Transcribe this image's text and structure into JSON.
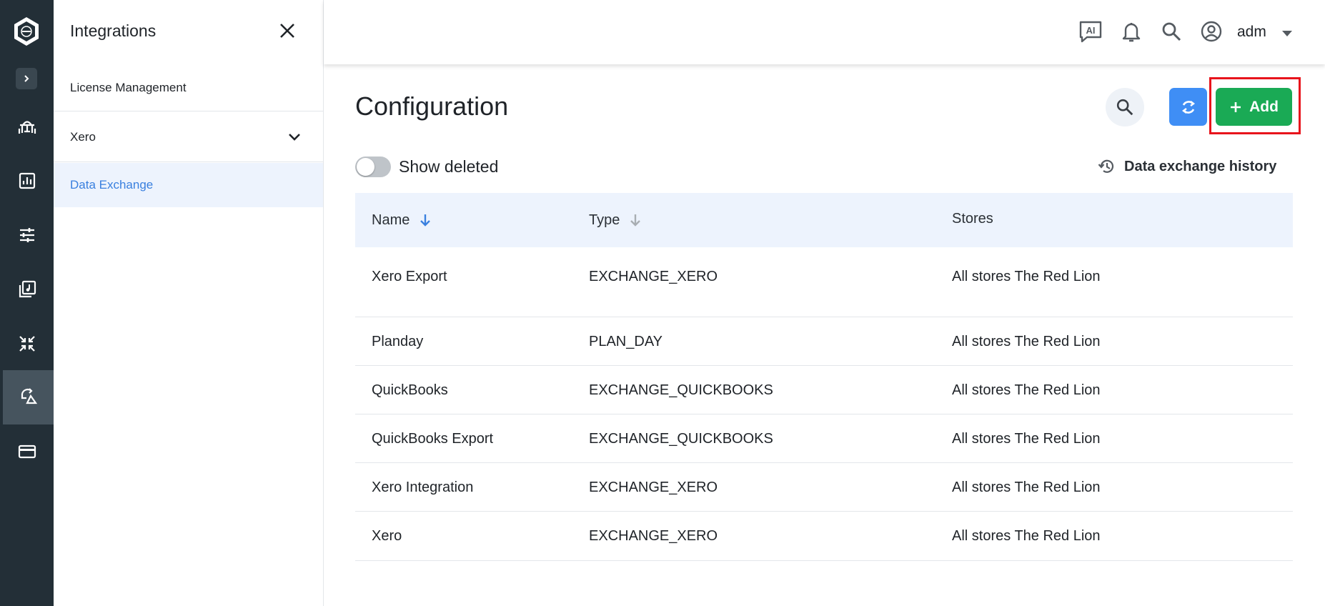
{
  "sidebar": {
    "title": "Integrations",
    "items": [
      {
        "label": "License Management"
      },
      {
        "label": "Xero"
      },
      {
        "label": "Data Exchange"
      }
    ]
  },
  "header": {
    "user": "adm",
    "icons": [
      "ai-chat-icon",
      "bell-icon",
      "search-icon",
      "account-circle-icon",
      "caret-down-icon"
    ]
  },
  "main": {
    "title": "Configuration",
    "add_label": "Add",
    "show_deleted_label": "Show deleted",
    "show_deleted_on": false,
    "history_label": "Data exchange history"
  },
  "table": {
    "columns": [
      "Name",
      "Type",
      "Stores"
    ],
    "rows": [
      {
        "name": "Xero Export",
        "type": "EXCHANGE_XERO",
        "stores": "All stores The Red Lion"
      },
      {
        "name": "Planday",
        "type": "PLAN_DAY",
        "stores": "All stores The Red Lion"
      },
      {
        "name": "QuickBooks",
        "type": "EXCHANGE_QUICKBOOKS",
        "stores": "All stores The Red Lion"
      },
      {
        "name": "QuickBooks Export",
        "type": "EXCHANGE_QUICKBOOKS",
        "stores": "All stores The Red Lion"
      },
      {
        "name": "Xero Integration",
        "type": "EXCHANGE_XERO",
        "stores": "All stores The Red Lion"
      },
      {
        "name": "Xero",
        "type": "EXCHANGE_XERO",
        "stores": "All stores The Red Lion"
      }
    ]
  },
  "colors": {
    "rail_bg": "#232f37",
    "accent_blue": "#3a80df",
    "add_green": "#1aaa55",
    "refresh_blue": "#3f8ef5",
    "highlight_red": "#e8141c"
  }
}
